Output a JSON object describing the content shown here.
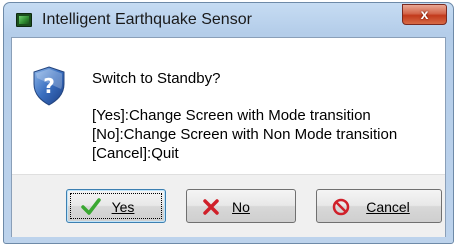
{
  "window": {
    "title": "Intelligent Earthquake Sensor",
    "close_glyph": "x"
  },
  "dialog": {
    "question": "Switch to Standby?",
    "details": [
      "[Yes]:Change Screen with Mode transition",
      "[No]:Change Screen with Non Mode transition",
      "[Cancel]:Quit"
    ],
    "icon": "shield-question-icon"
  },
  "buttons": {
    "yes": {
      "label": "Yes",
      "icon": "green-check-icon"
    },
    "no": {
      "label": "No",
      "icon": "red-x-icon"
    },
    "cancel": {
      "label": "Cancel",
      "icon": "red-prohibit-icon"
    }
  },
  "colors": {
    "title_bar": "#c6dcf3",
    "close_button": "#c23a1c",
    "check_green": "#3aa832",
    "x_red": "#d0202a"
  }
}
